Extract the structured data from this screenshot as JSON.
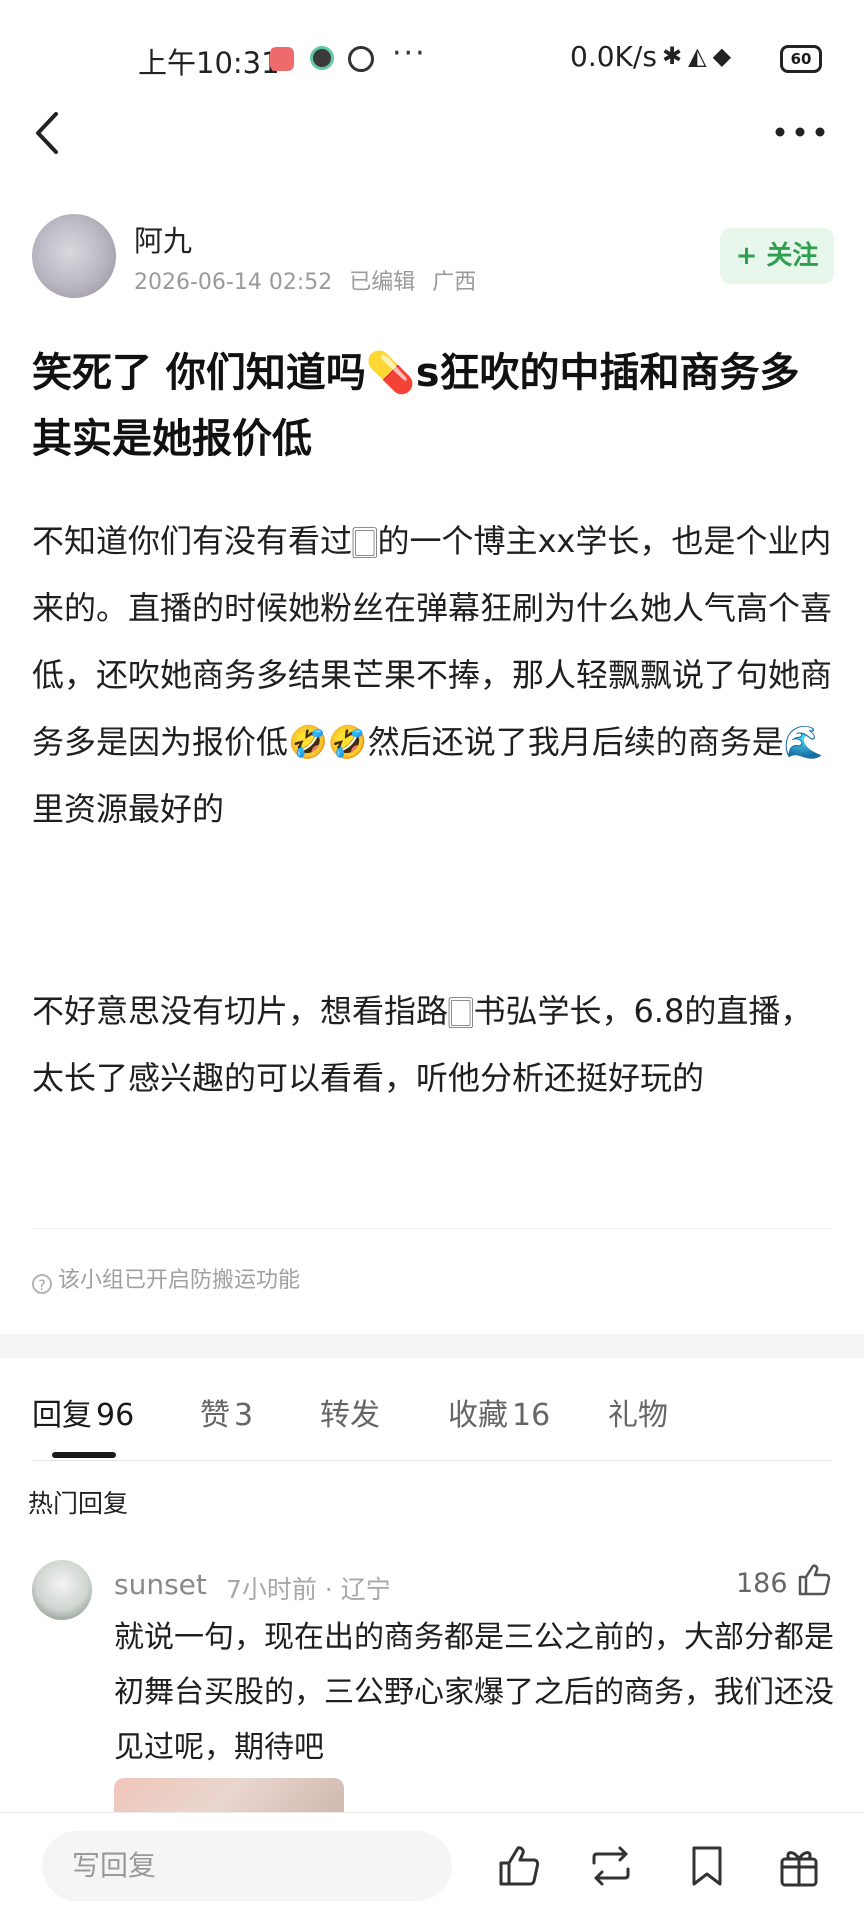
{
  "status_bar": {
    "time": "上午10:31",
    "more": "···",
    "net_speed": "0.0K/s",
    "battery": "60"
  },
  "post": {
    "author": "阿九",
    "date": "2026-06-14 02:52",
    "edited": "已编辑",
    "location": "广西",
    "follow_label": "+ 关注",
    "title": "笑死了 你们知道吗💊s狂吹的中插和商务多其实是她报价低",
    "paragraph1": "不知道你们有没有看过🀆的一个博主xx学长，也是个业内来的。直播的时候她粉丝在弹幕狂刷为什么她人气高个喜低，还吹她商务多结果芒果不捧，那人轻飘飘说了句她商务多是因为报价低🤣🤣然后还说了我月后续的商务是🌊里资源最好的",
    "paragraph2": "不好意思没有切片，想看指路🀆书弘学长，6.8的直播，太长了感兴趣的可以看看，听他分析还挺好玩的",
    "notice": "该小组已开启防搬运功能"
  },
  "tabs": [
    {
      "label": "回复",
      "count": "96"
    },
    {
      "label": "赞",
      "count": "3"
    },
    {
      "label": "转发",
      "count": ""
    },
    {
      "label": "收藏",
      "count": "16"
    },
    {
      "label": "礼物",
      "count": ""
    }
  ],
  "hot_replies_label": "热门回复",
  "comment": {
    "user": "sunset",
    "time_location": "7小时前 · 辽宁",
    "likes": "186",
    "text": "就说一句，现在出的商务都是三公之前的，大部分都是初舞台买股的，三公野心家爆了之后的商务，我们还没见过呢，期待吧"
  },
  "bottom_bar": {
    "reply_placeholder": "写回复"
  },
  "colors": {
    "follow_green": "#2f9e4f",
    "follow_bg": "#e8f7ec"
  }
}
